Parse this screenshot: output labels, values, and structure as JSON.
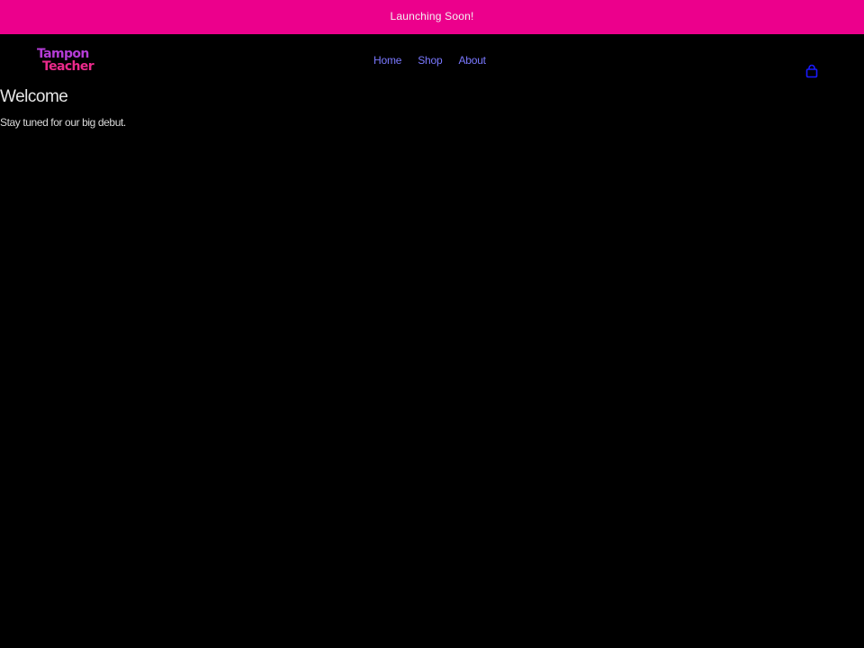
{
  "announcement": {
    "text": "Launching Soon!",
    "background_color": "#ec008c"
  },
  "header": {
    "logo": {
      "line1": "Tampon",
      "line2": "Teacher",
      "colors": [
        "#b43cd6",
        "#ec2a8c"
      ]
    },
    "nav": {
      "items": [
        {
          "label": "Home"
        },
        {
          "label": "Shop"
        },
        {
          "label": "About"
        }
      ],
      "link_color": "#7a78ff"
    },
    "cart_icon": "shopping-bag-icon"
  },
  "main": {
    "heading": "Welcome",
    "subtext": "Stay tuned for our big debut."
  },
  "theme": {
    "page_background": "#000000",
    "text_color": "#e6e6e6",
    "icon_color": "#1a1aff"
  }
}
